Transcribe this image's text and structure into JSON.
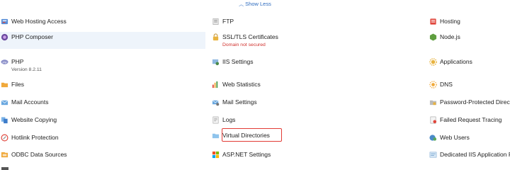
{
  "header": {
    "show_less": "Show Less"
  },
  "col1": [
    {
      "label": "Web Hosting Access",
      "icon": "web-hosting-access-icon"
    },
    {
      "label": "PHP Composer",
      "icon": "php-composer-icon"
    },
    {
      "label": "PHP",
      "icon": "php-icon",
      "sub": "Version 8.2.11"
    },
    {
      "label": "Files",
      "icon": "folder-icon"
    },
    {
      "label": "Mail Accounts",
      "icon": "mail-icon"
    },
    {
      "label": "Website Copying",
      "icon": "copy-icon"
    },
    {
      "label": "Hotlink Protection",
      "icon": "hotlink-icon"
    },
    {
      "label": "ODBC Data Sources",
      "icon": "odbc-icon"
    }
  ],
  "col2": [
    {
      "label": "FTP",
      "icon": "ftp-icon"
    },
    {
      "label": "SSL/TLS Certificates",
      "icon": "lock-icon",
      "sub": "Domain not secured"
    },
    {
      "label": "IIS Settings",
      "icon": "iis-settings-icon"
    },
    {
      "label": "Web Statistics",
      "icon": "statistics-icon"
    },
    {
      "label": "Mail Settings",
      "icon": "mail-settings-icon"
    },
    {
      "label": "Logs",
      "icon": "logs-icon"
    },
    {
      "label": "Virtual Directories",
      "icon": "virtual-directories-icon"
    },
    {
      "label": "ASP.NET Settings",
      "icon": "aspnet-icon"
    }
  ],
  "col3": [
    {
      "label": "Hosting",
      "icon": "hosting-icon"
    },
    {
      "label": "Node.js",
      "icon": "nodejs-icon"
    },
    {
      "label": "Applications",
      "icon": "applications-icon"
    },
    {
      "label": "DNS",
      "icon": "dns-icon"
    },
    {
      "label": "Password-Protected Directories",
      "icon": "password-protected-icon"
    },
    {
      "label": "Failed Request Tracing",
      "icon": "failed-request-icon"
    },
    {
      "label": "Web Users",
      "icon": "web-users-icon"
    },
    {
      "label": "Dedicated IIS Application Pool",
      "icon": "app-pool-icon"
    }
  ],
  "colors": {
    "accent": "#2d6bbf",
    "warning": "#d0312d",
    "highlight_box": "#e23b35",
    "row_highlight": "#eef4fb"
  }
}
